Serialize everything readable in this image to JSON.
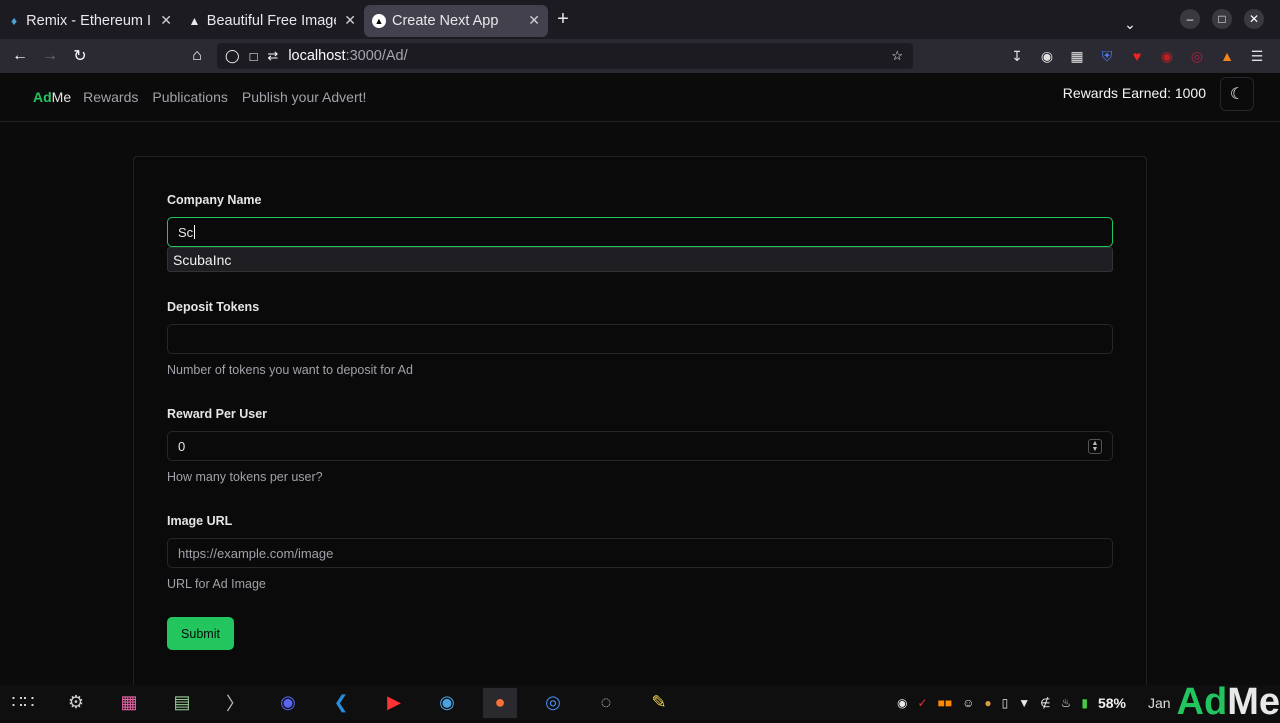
{
  "browser": {
    "tabs": [
      {
        "title": "Remix - Ethereum IDE",
        "icon": "remix-icon",
        "active": false
      },
      {
        "title": "Beautiful Free Images",
        "icon": "unsplash-icon",
        "active": false
      },
      {
        "title": "Create Next App",
        "icon": "nextjs-icon",
        "active": true
      }
    ],
    "url_host": "localhost",
    "url_path": ":3000/Ad/"
  },
  "app": {
    "brand_ad": "Ad",
    "brand_me": "Me",
    "nav": [
      "Rewards",
      "Publications",
      "Publish your Advert!"
    ],
    "rewards_text": "Rewards Earned: 1000"
  },
  "form": {
    "company": {
      "label": "Company Name",
      "value": "Sc",
      "suggestion": "ScubaInc"
    },
    "deposit": {
      "label": "Deposit Tokens",
      "value": "",
      "help": "Number of tokens you want to deposit for Ad"
    },
    "reward": {
      "label": "Reward Per User",
      "value": "0",
      "help": "How many tokens per user?"
    },
    "image": {
      "label": "Image URL",
      "placeholder": "https://example.com/image",
      "help": "URL for Ad Image"
    },
    "submit_label": "Submit"
  },
  "taskbar": {
    "battery": "58%",
    "date": "Jan",
    "watermark_ad": "Ad",
    "watermark_me": "Me"
  }
}
